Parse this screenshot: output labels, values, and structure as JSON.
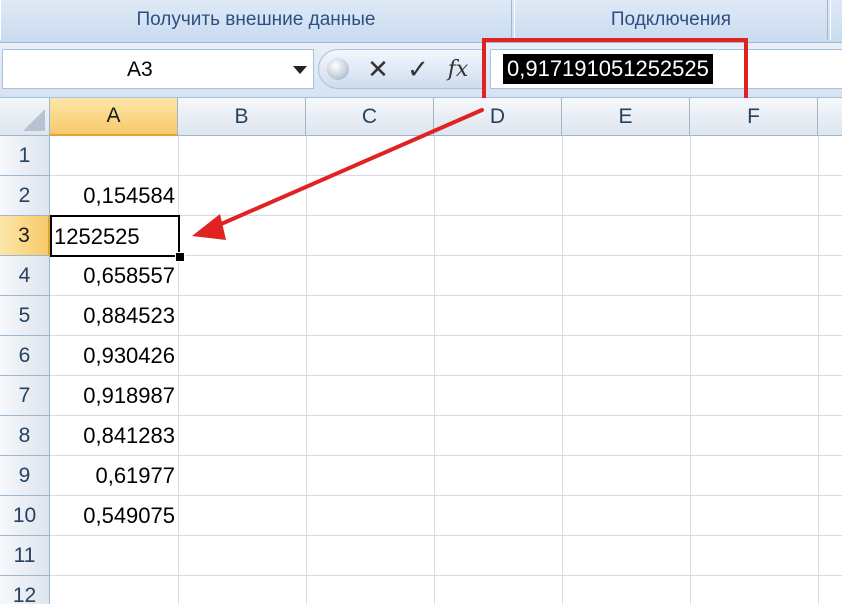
{
  "ribbon": {
    "groups": [
      "Получить внешние данные",
      "Подключения"
    ]
  },
  "formula_bar": {
    "name_box": "A3",
    "formula_value": "0,917191051252525",
    "icons": [
      "cancel-icon",
      "enter-icon",
      "function-icon"
    ]
  },
  "grid": {
    "columns": [
      "A",
      "B",
      "C",
      "D",
      "E",
      "F"
    ],
    "active_column": "A",
    "rows": [
      "1",
      "2",
      "3",
      "4",
      "5",
      "6",
      "7",
      "8",
      "9",
      "10",
      "11",
      "12"
    ],
    "active_row": "3",
    "column_a_values": [
      "",
      "0,154584",
      "",
      "0,658557",
      "0,884523",
      "0,930426",
      "0,918987",
      "0,841283",
      "0,61977",
      "0,549075",
      "",
      ""
    ],
    "active_cell_display": "1252525"
  },
  "annotation": {
    "color": "#e02222"
  }
}
